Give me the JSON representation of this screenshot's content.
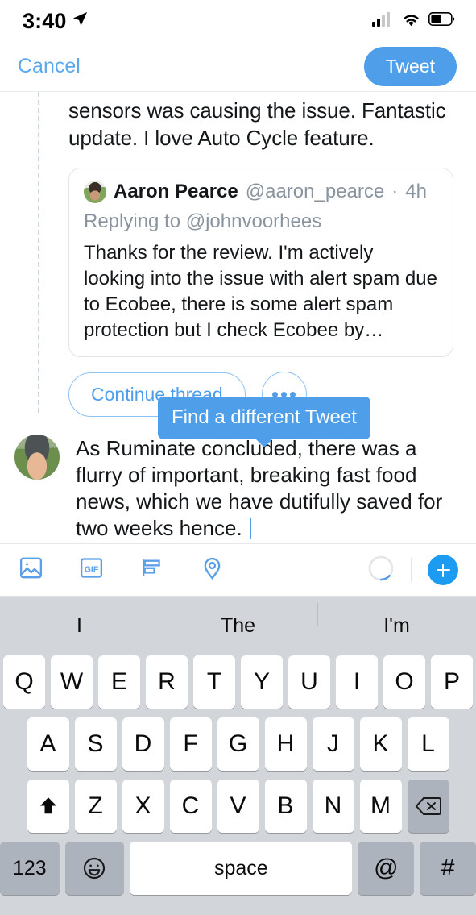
{
  "status_bar": {
    "time": "3:40",
    "location_icon": "location-arrow-icon",
    "signal_icon": "cellular-signal-icon",
    "wifi_icon": "wifi-icon",
    "battery_icon": "battery-icon"
  },
  "nav": {
    "cancel_label": "Cancel",
    "tweet_label": "Tweet"
  },
  "previous_tweet": {
    "text": "sensors was causing the issue. Fantastic update. I love Auto Cycle feature."
  },
  "quoted_tweet": {
    "display_name": "Aaron Pearce",
    "handle": "@aaron_pearce",
    "separator": "·",
    "timestamp": "4h",
    "replying_to": "Replying to @johnvoorhees",
    "body": "Thanks for the review.  I'm actively looking into the issue with alert spam due to Ecobee, there is some alert spam protection but I check Ecobee by…"
  },
  "actions": {
    "continue_thread_label": "Continue thread",
    "more_label": "more-options"
  },
  "tooltip": {
    "text": "Find a different Tweet"
  },
  "compose": {
    "text": "As Ruminate concluded, there was a flurry of important, breaking fast food news, which we have dutifully saved for two weeks hence.",
    "avatar": "user-avatar"
  },
  "toolbar": {
    "items": [
      {
        "name": "photo-icon",
        "label": "Photo"
      },
      {
        "name": "gif-icon",
        "label": "GIF"
      },
      {
        "name": "poll-icon",
        "label": "Poll"
      },
      {
        "name": "location-icon",
        "label": "Location"
      }
    ],
    "char_counter": "character-count-ring",
    "add_label": "+"
  },
  "keyboard": {
    "predictions": [
      "I",
      "The",
      "I'm"
    ],
    "row1": [
      "Q",
      "W",
      "E",
      "R",
      "T",
      "Y",
      "U",
      "I",
      "O",
      "P"
    ],
    "row2": [
      "A",
      "S",
      "D",
      "F",
      "G",
      "H",
      "J",
      "K",
      "L"
    ],
    "row3": [
      "Z",
      "X",
      "C",
      "V",
      "B",
      "N",
      "M"
    ],
    "shift_label": "shift-key",
    "backspace_label": "backspace-key",
    "numbers_label": "123",
    "emoji_label": "emoji-key",
    "space_label": "space",
    "at_label": "@",
    "hash_label": "#"
  },
  "colors": {
    "accent": "#4f9eea",
    "keyboard_bg": "#d2d5da",
    "text": "#14171a",
    "muted": "#8a949e"
  }
}
